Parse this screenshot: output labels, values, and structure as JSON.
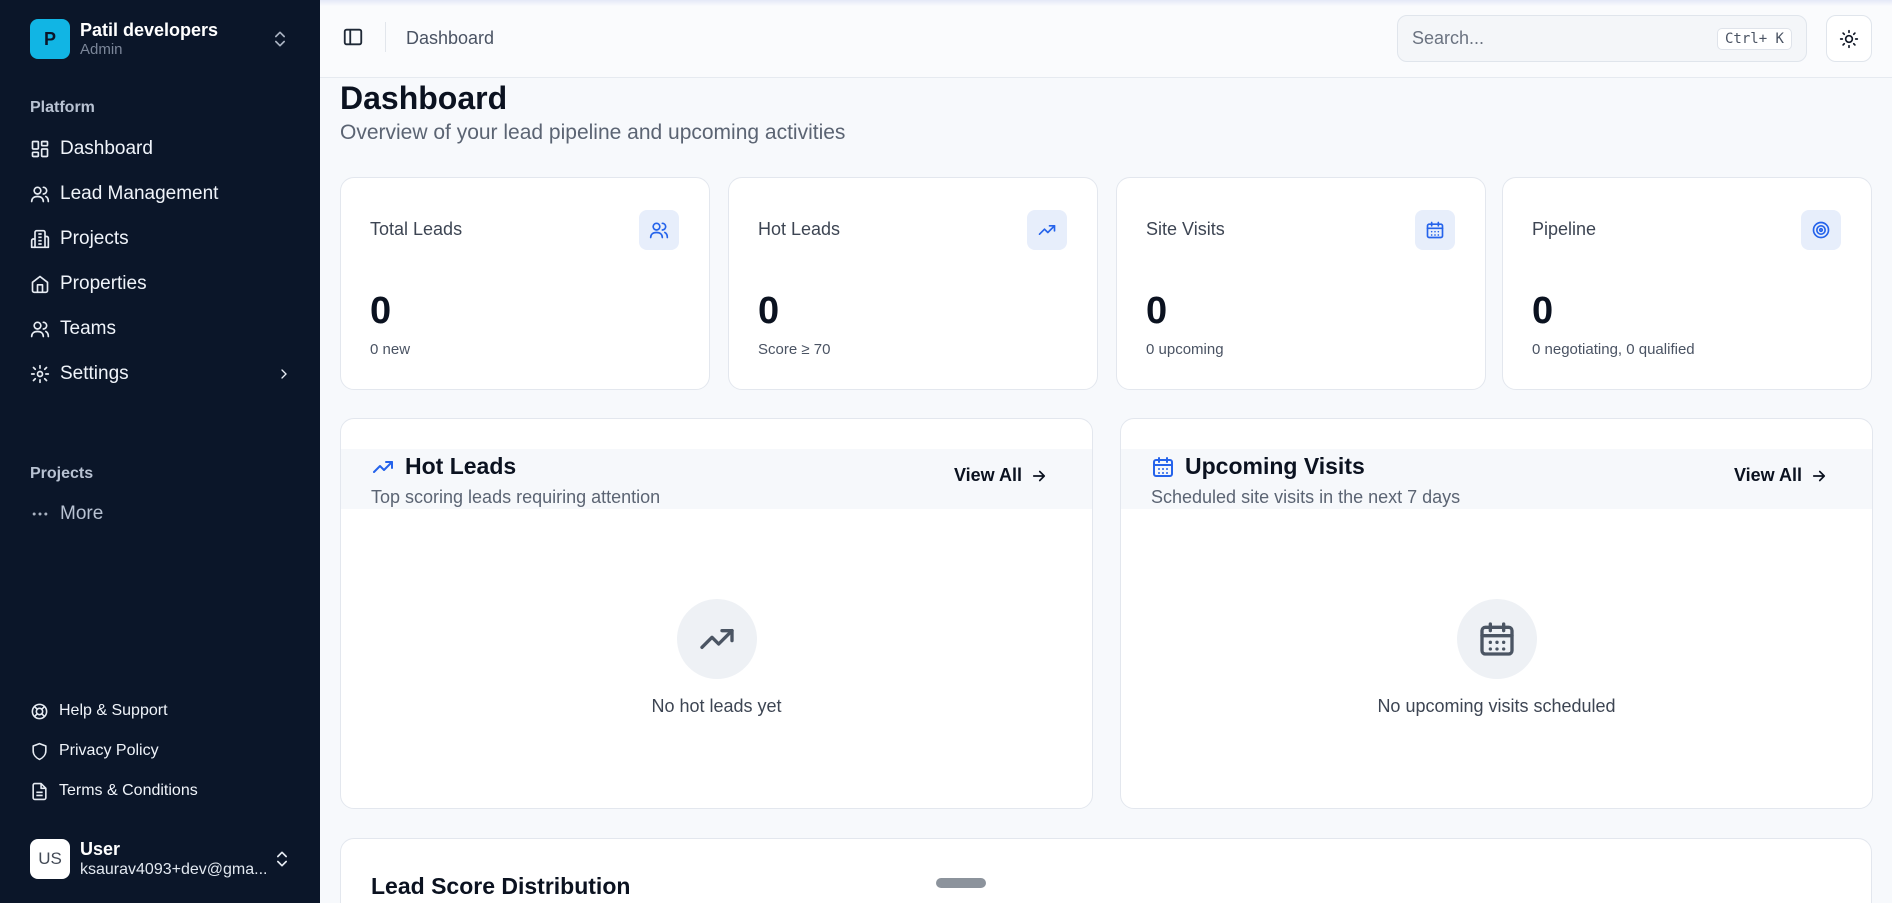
{
  "sidebar": {
    "brand": {
      "initial": "P",
      "name": "Patil developers",
      "role": "Admin"
    },
    "platform_label": "Platform",
    "nav": [
      {
        "label": "Dashboard",
        "icon": "dashboard-icon"
      },
      {
        "label": "Lead Management",
        "icon": "users-icon"
      },
      {
        "label": "Projects",
        "icon": "building-icon"
      },
      {
        "label": "Properties",
        "icon": "home-icon"
      },
      {
        "label": "Teams",
        "icon": "users-icon"
      },
      {
        "label": "Settings",
        "icon": "gear-icon"
      }
    ],
    "projects_label": "Projects",
    "more_label": "More",
    "footer_links": [
      {
        "label": "Help & Support",
        "icon": "lifebuoy-icon"
      },
      {
        "label": "Privacy Policy",
        "icon": "shield-icon"
      },
      {
        "label": "Terms & Conditions",
        "icon": "document-icon"
      }
    ],
    "user": {
      "initials": "US",
      "name": "User",
      "email": "ksaurav4093+dev@gma..."
    }
  },
  "topbar": {
    "breadcrumb": "Dashboard",
    "search_placeholder": "Search...",
    "search_shortcut": "Ctrl+ K"
  },
  "page": {
    "title": "Dashboard",
    "subtitle": "Overview of your lead pipeline and upcoming activities"
  },
  "stats": [
    {
      "label": "Total Leads",
      "value": "0",
      "note": "0 new",
      "icon": "users-icon"
    },
    {
      "label": "Hot Leads",
      "value": "0",
      "note": "Score ≥ 70",
      "icon": "trending-up-icon"
    },
    {
      "label": "Site Visits",
      "value": "0",
      "note": "0 upcoming",
      "icon": "calendar-icon"
    },
    {
      "label": "Pipeline",
      "value": "0",
      "note": "0 negotiating, 0 qualified",
      "icon": "target-icon"
    }
  ],
  "panels": {
    "hot_leads": {
      "title": "Hot Leads",
      "subtitle": "Top scoring leads requiring attention",
      "view_all": "View All",
      "empty": "No hot leads yet"
    },
    "upcoming_visits": {
      "title": "Upcoming Visits",
      "subtitle": "Scheduled site visits in the next 7 days",
      "view_all": "View All",
      "empty": "No upcoming visits scheduled"
    }
  },
  "distribution": {
    "title": "Lead Score Distribution"
  },
  "colors": {
    "sidebar_bg": "#0b1629",
    "brand_accent": "#11b5e4",
    "icon_accent": "#2563eb",
    "page_bg": "#f7f9fc"
  }
}
